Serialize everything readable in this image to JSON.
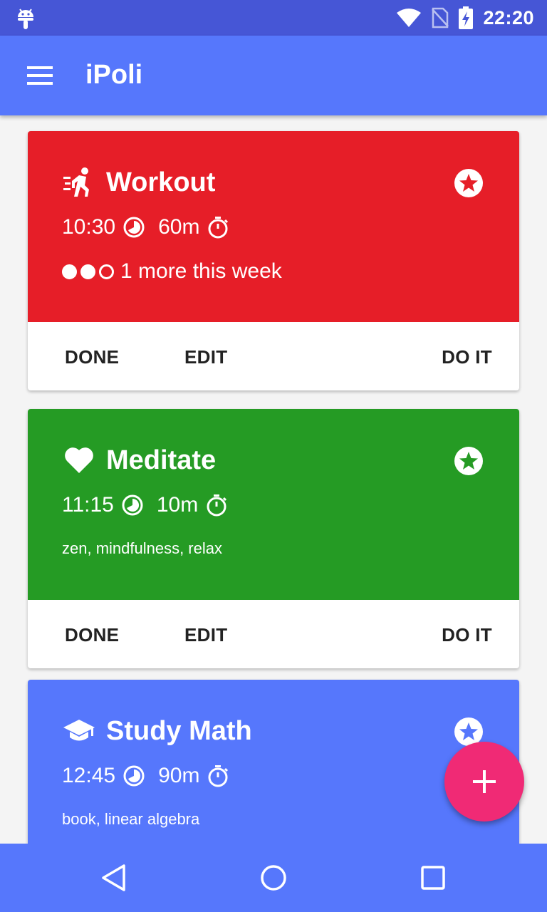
{
  "status_bar": {
    "time": "22:20"
  },
  "app_bar": {
    "title": "iPoli"
  },
  "quests": [
    {
      "name": "Workout",
      "category_icon": "running-icon",
      "color": "#e61e28",
      "start_time": "10:30",
      "duration": "60m",
      "progress": {
        "done": 2,
        "total": 3,
        "text": "1 more this week"
      },
      "tags": "",
      "actions": {
        "done": "DONE",
        "edit": "EDIT",
        "do_it": "DO IT"
      }
    },
    {
      "name": "Meditate",
      "category_icon": "heart-icon",
      "color": "#259b24",
      "start_time": "11:15",
      "duration": "10m",
      "tags": "zen, mindfulness, relax",
      "actions": {
        "done": "DONE",
        "edit": "EDIT",
        "do_it": "DO IT"
      }
    },
    {
      "name": "Study Math",
      "category_icon": "graduation-cap-icon",
      "color": "#5677fc",
      "start_time": "12:45",
      "duration": "90m",
      "tags": "book, linear algebra"
    }
  ],
  "colors": {
    "status_bar": "#4656d6",
    "primary": "#5677fc",
    "fab": "#f02a75"
  }
}
